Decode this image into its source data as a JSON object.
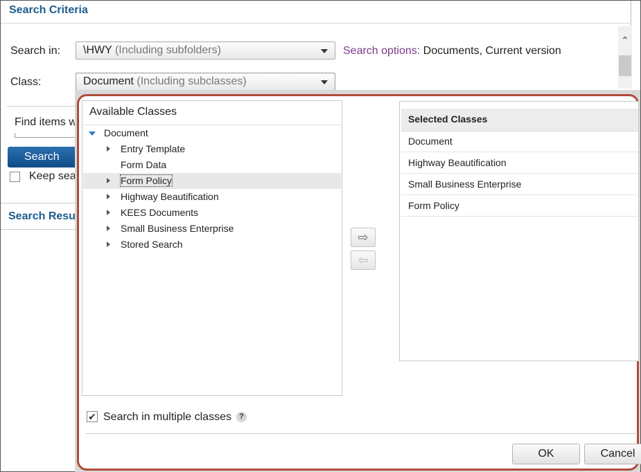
{
  "criteria": {
    "title": "Search Criteria",
    "search_in_label": "Search in:",
    "search_in_value": "\\HWY",
    "search_in_hint": "(Including subfolders)",
    "class_label": "Class:",
    "class_value": "Document",
    "class_hint": "(Including subclasses)",
    "search_options_key": "Search options:",
    "search_options_value": "Documents, Current version",
    "find_items_label": "Find items w",
    "search_button": "Search",
    "keep_label": "Keep sea",
    "results_title": "Search Resu"
  },
  "dialog": {
    "available_title": "Available Classes",
    "tree": [
      {
        "label": "Document",
        "twisty": "expanded",
        "level": 0
      },
      {
        "label": "Entry Template",
        "twisty": "collapsed",
        "level": 1
      },
      {
        "label": "Form Data",
        "twisty": "none",
        "level": 1
      },
      {
        "label": "Form Policy",
        "twisty": "collapsed",
        "level": 1,
        "selected": true
      },
      {
        "label": "Highway Beautification",
        "twisty": "collapsed",
        "level": 1
      },
      {
        "label": "KEES Documents",
        "twisty": "collapsed",
        "level": 1
      },
      {
        "label": "Small Business Enterprise",
        "twisty": "collapsed",
        "level": 1
      },
      {
        "label": "Stored Search",
        "twisty": "collapsed",
        "level": 1
      }
    ],
    "add_arrow_icon": "arrow-right-icon",
    "remove_arrow_icon": "arrow-left-icon",
    "selected_title": "Selected Classes",
    "selected": [
      "Document",
      "Highway Beautification",
      "Small Business Enterprise",
      "Form Policy"
    ],
    "multi_label": "Search in multiple classes",
    "multi_checked": true,
    "help_icon": "?",
    "ok_label": "OK",
    "cancel_label": "Cancel"
  },
  "colors": {
    "accent": "#1c5d8e",
    "dialog_border": "#b14a3a",
    "search_options_key": "#7b3b8c",
    "tree_expand": "#2b7bc0"
  }
}
